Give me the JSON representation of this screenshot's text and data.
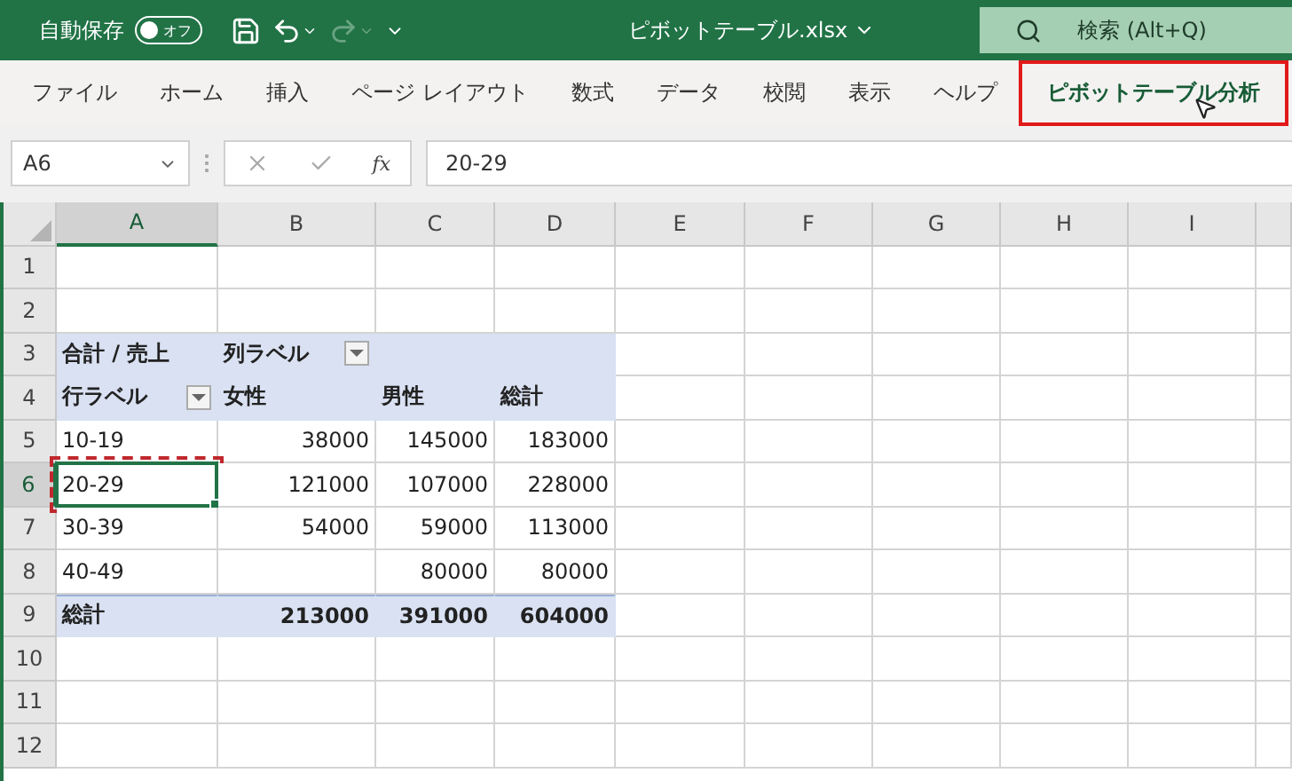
{
  "title_bar": {
    "autosave_label": "自動保存",
    "autosave_toggle": {
      "label": "オフ",
      "on": false
    },
    "redo_disabled": true,
    "filename": "ピボットテーブル.xlsx",
    "search": {
      "placeholder": "検索 (Alt+Q)"
    }
  },
  "ribbon_tabs": [
    {
      "label": "ファイル",
      "selected": false
    },
    {
      "label": "ホーム",
      "selected": false
    },
    {
      "label": "挿入",
      "selected": false
    },
    {
      "label": "ページ レイアウト",
      "selected": false
    },
    {
      "label": "数式",
      "selected": false
    },
    {
      "label": "データ",
      "selected": false
    },
    {
      "label": "校閲",
      "selected": false
    },
    {
      "label": "表示",
      "selected": false
    },
    {
      "label": "ヘルプ",
      "selected": false
    },
    {
      "label": "ピボットテーブル分析",
      "selected": true
    }
  ],
  "formula_bar": {
    "name_box": "A6",
    "fx_label": "fx",
    "formula": "20-29"
  },
  "sheet": {
    "columns": [
      {
        "label": "A",
        "selected": true
      },
      {
        "label": "B",
        "selected": false
      },
      {
        "label": "C",
        "selected": false
      },
      {
        "label": "D",
        "selected": false
      },
      {
        "label": "E",
        "selected": false
      },
      {
        "label": "F",
        "selected": false
      },
      {
        "label": "G",
        "selected": false
      },
      {
        "label": "H",
        "selected": false
      },
      {
        "label": "I",
        "selected": false
      }
    ],
    "rows": [
      {
        "number": "1",
        "selected": false,
        "kind": "blank"
      },
      {
        "number": "2",
        "selected": false,
        "kind": "blank"
      },
      {
        "number": "3",
        "selected": false,
        "kind": "header",
        "cells": [
          {
            "text": "合計 / 売上",
            "filter": false
          },
          {
            "text": "列ラベル",
            "filter": true
          },
          null,
          null
        ]
      },
      {
        "number": "4",
        "selected": false,
        "kind": "header",
        "cells": [
          {
            "text": "行ラベル",
            "filter": true
          },
          {
            "text": "女性",
            "filter": false
          },
          {
            "text": "男性",
            "filter": false
          },
          {
            "text": "総計",
            "filter": false
          }
        ]
      },
      {
        "number": "5",
        "selected": false,
        "kind": "data",
        "cells": [
          {
            "text": "10-19",
            "filter": false
          },
          {
            "text": "38000",
            "filter": false
          },
          {
            "text": "145000",
            "filter": false
          },
          {
            "text": "183000",
            "filter": false
          }
        ]
      },
      {
        "number": "6",
        "selected": true,
        "kind": "data",
        "cells": [
          {
            "text": "20-29",
            "filter": false
          },
          {
            "text": "121000",
            "filter": false
          },
          {
            "text": "107000",
            "filter": false
          },
          {
            "text": "228000",
            "filter": false
          }
        ]
      },
      {
        "number": "7",
        "selected": false,
        "kind": "data",
        "cells": [
          {
            "text": "30-39",
            "filter": false
          },
          {
            "text": "54000",
            "filter": false
          },
          {
            "text": "59000",
            "filter": false
          },
          {
            "text": "113000",
            "filter": false
          }
        ]
      },
      {
        "number": "8",
        "selected": false,
        "kind": "data",
        "cells": [
          {
            "text": "40-49",
            "filter": false
          },
          null,
          {
            "text": "80000",
            "filter": false
          },
          {
            "text": "80000",
            "filter": false
          }
        ]
      },
      {
        "number": "9",
        "selected": false,
        "kind": "total",
        "cells": [
          {
            "text": "総計",
            "filter": false
          },
          {
            "text": "213000",
            "filter": false
          },
          {
            "text": "391000",
            "filter": false
          },
          {
            "text": "604000",
            "filter": false
          }
        ]
      },
      {
        "number": "10",
        "selected": false,
        "kind": "blank"
      },
      {
        "number": "11",
        "selected": false,
        "kind": "blank"
      },
      {
        "number": "12",
        "selected": false,
        "kind": "blank"
      }
    ]
  }
}
